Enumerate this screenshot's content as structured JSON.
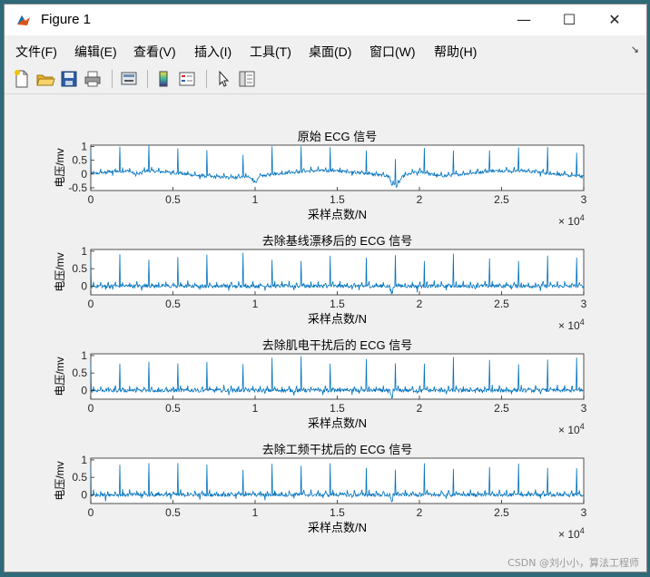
{
  "window": {
    "title": "Figure 1",
    "controls": {
      "minimize": "—",
      "maximize": "☐",
      "close": "✕"
    }
  },
  "menu": {
    "items": [
      "文件(F)",
      "编辑(E)",
      "查看(V)",
      "插入(I)",
      "工具(T)",
      "桌面(D)",
      "窗口(W)",
      "帮助(H)"
    ],
    "overflow_arrow": "↘"
  },
  "toolbar": {
    "icons": [
      "new-figure-icon",
      "open-file-icon",
      "save-icon",
      "print-icon",
      "link-plot-icon",
      "colorbar-icon",
      "legend-icon",
      "pointer-icon",
      "property-editor-icon"
    ]
  },
  "watermark": "CSDN @刘小小，算法工程师",
  "colors": {
    "line": "#0072bd",
    "axes_bg": "#ffffff",
    "figure_bg": "#f0f0f0"
  },
  "chart_data": [
    {
      "type": "line",
      "title": "原始 ECG 信号",
      "xlabel": "采样点数/N",
      "ylabel": "电压/mv",
      "xlim": [
        0,
        30000
      ],
      "ylim": [
        -0.6,
        1.05
      ],
      "x_ticks": [
        "0",
        "0.5",
        "1",
        "1.5",
        "2",
        "2.5",
        "3"
      ],
      "y_ticks": [
        "1",
        "0.5",
        "0",
        "-0.5"
      ],
      "x_exponent": "× 10^4",
      "baseline_wander": true,
      "series": [
        {
          "approx_beats": 68,
          "peak": 1.0,
          "baseline": 0.0
        }
      ]
    },
    {
      "type": "line",
      "title": "去除基线漂移后的 ECG 信号",
      "xlabel": "采样点数/N",
      "ylabel": "电压/mv",
      "xlim": [
        0,
        30000
      ],
      "ylim": [
        -0.25,
        1.05
      ],
      "x_ticks": [
        "0",
        "0.5",
        "1",
        "1.5",
        "2",
        "2.5",
        "3"
      ],
      "y_ticks": [
        "1",
        "0.5",
        "0"
      ],
      "x_exponent": "× 10^4",
      "baseline_wander": false,
      "series": [
        {
          "approx_beats": 68,
          "peak": 0.95,
          "baseline": 0.0
        }
      ]
    },
    {
      "type": "line",
      "title": "去除肌电干扰后的 ECG 信号",
      "xlabel": "采样点数/N",
      "ylabel": "电压/mv",
      "xlim": [
        0,
        30000
      ],
      "ylim": [
        -0.25,
        1.05
      ],
      "x_ticks": [
        "0",
        "0.5",
        "1",
        "1.5",
        "2",
        "2.5",
        "3"
      ],
      "y_ticks": [
        "1",
        "0.5",
        "0"
      ],
      "x_exponent": "× 10^4",
      "baseline_wander": false,
      "series": [
        {
          "approx_beats": 68,
          "peak": 0.95,
          "baseline": 0.0
        }
      ]
    },
    {
      "type": "line",
      "title": "去除工频干扰后的 ECG 信号",
      "xlabel": "采样点数/N",
      "ylabel": "电压/mv",
      "xlim": [
        0,
        30000
      ],
      "ylim": [
        -0.25,
        1.05
      ],
      "x_ticks": [
        "0",
        "0.5",
        "1",
        "1.5",
        "2",
        "2.5",
        "3"
      ],
      "y_ticks": [
        "1",
        "0.5",
        "0"
      ],
      "x_exponent": "× 10^4",
      "baseline_wander": false,
      "series": [
        {
          "approx_beats": 68,
          "peak": 0.95,
          "baseline": 0.0
        }
      ]
    }
  ]
}
